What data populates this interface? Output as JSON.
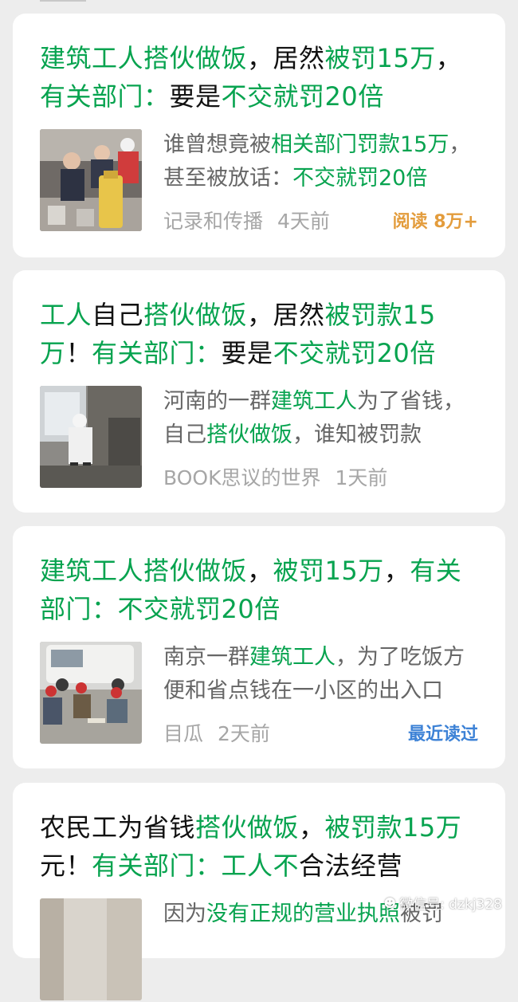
{
  "articles": [
    {
      "title_parts": [
        {
          "text": "建筑工人搭伙做饭",
          "hl": true
        },
        {
          "text": "，居然",
          "hl": false
        },
        {
          "text": "被罚15万",
          "hl": true
        },
        {
          "text": "，",
          "hl": false
        },
        {
          "text": "有关部门：",
          "hl": true
        },
        {
          "text": "要是",
          "hl": false
        },
        {
          "text": "不交就罚20倍",
          "hl": true
        }
      ],
      "summary_parts": [
        {
          "text": "谁曾想竟被",
          "hl": false
        },
        {
          "text": "相关部门罚款15万",
          "hl": true
        },
        {
          "text": "，甚至被放话：",
          "hl": false
        },
        {
          "text": "不交就罚20倍",
          "hl": true
        }
      ],
      "source": "记录和传播",
      "time": "4天前",
      "read_count": "阅读 8万+",
      "recent_read": "",
      "image": "kitchen-inspection-photo"
    },
    {
      "title_parts": [
        {
          "text": "工人",
          "hl": true
        },
        {
          "text": "自己",
          "hl": false
        },
        {
          "text": "搭伙做饭",
          "hl": true
        },
        {
          "text": "，居然",
          "hl": false
        },
        {
          "text": "被罚款15万",
          "hl": true
        },
        {
          "text": "！",
          "hl": false
        },
        {
          "text": "有关部门：",
          "hl": true
        },
        {
          "text": "要是",
          "hl": false
        },
        {
          "text": "不交就罚20倍",
          "hl": true
        }
      ],
      "summary_parts": [
        {
          "text": "河南的一群",
          "hl": false
        },
        {
          "text": "建筑工人",
          "hl": true
        },
        {
          "text": "为了省钱，自己",
          "hl": false
        },
        {
          "text": "搭伙做饭",
          "hl": true
        },
        {
          "text": "，谁知被罚款",
          "hl": false
        }
      ],
      "source": "BOOK思议的世界",
      "time": "1天前",
      "read_count": "",
      "recent_read": "",
      "image": "cook-in-kitchen-photo"
    },
    {
      "title_parts": [
        {
          "text": "建筑工人搭伙做饭",
          "hl": true
        },
        {
          "text": "，",
          "hl": false
        },
        {
          "text": "被罚15万",
          "hl": true
        },
        {
          "text": "，",
          "hl": false
        },
        {
          "text": "有关部门：不交就罚20倍",
          "hl": true
        }
      ],
      "summary_parts": [
        {
          "text": "南京一群",
          "hl": false
        },
        {
          "text": "建筑工人",
          "hl": true
        },
        {
          "text": "，为了吃饭方便和省点钱在一小区的出入口",
          "hl": false
        }
      ],
      "source": "目瓜",
      "time": "2天前",
      "read_count": "",
      "recent_read": "最近读过",
      "image": "workers-eating-photo"
    },
    {
      "title_parts": [
        {
          "text": "农民工为省钱",
          "hl": false
        },
        {
          "text": "搭伙做饭",
          "hl": true
        },
        {
          "text": "，",
          "hl": false
        },
        {
          "text": "被罚款15万",
          "hl": true
        },
        {
          "text": "元！",
          "hl": false
        },
        {
          "text": "有关部门：工人不",
          "hl": true
        },
        {
          "text": "合法经营",
          "hl": false
        }
      ],
      "summary_parts": [
        {
          "text": "因为",
          "hl": false
        },
        {
          "text": "没有正规的营业执照",
          "hl": true
        },
        {
          "text": "被罚",
          "hl": false
        }
      ],
      "source": "",
      "time": "",
      "read_count": "",
      "recent_read": "",
      "image": "room-photo"
    }
  ],
  "watermark": {
    "icon": "wechat-icon",
    "text": "微信号: dzkj328"
  },
  "colors": {
    "highlight": "#07a34f",
    "read_count": "#e39c3c",
    "recent_read": "#3d82d6"
  }
}
